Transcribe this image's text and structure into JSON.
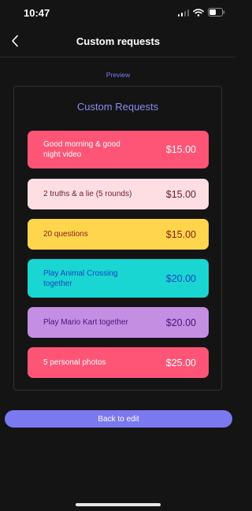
{
  "status_bar": {
    "time": "10:47"
  },
  "nav": {
    "title": "Custom requests"
  },
  "preview_label": "Preview",
  "card": {
    "title": "Custom Requests"
  },
  "requests": [
    {
      "label": "Good morning & good night video",
      "price": "$15.00",
      "bg": "#fe5577",
      "fg": "#ffffff"
    },
    {
      "label": "2 truths & a lie (5 rounds)",
      "price": "$15.00",
      "bg": "#ffdee3",
      "fg": "#6b2036"
    },
    {
      "label": "20 questions",
      "price": "$15.00",
      "bg": "#ffd54c",
      "fg": "#8a1c1c"
    },
    {
      "label": "Play Animal Crossing together",
      "price": "$20.00",
      "bg": "#19d6d3",
      "fg": "#1a44c2"
    },
    {
      "label": "Play Mario Kart together",
      "price": "$20.00",
      "bg": "#c48ee2",
      "fg": "#4a1478"
    },
    {
      "label": "5 personal photos",
      "price": "$25.00",
      "bg": "#fe5577",
      "fg": "#ffffff"
    }
  ],
  "back_to_edit": "Back to edit"
}
